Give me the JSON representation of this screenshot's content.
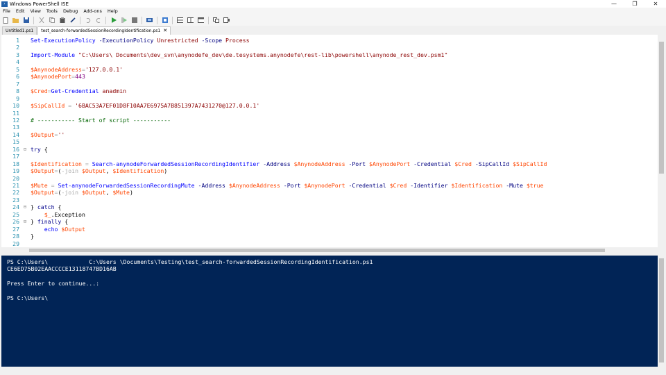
{
  "window": {
    "title": "Windows PowerShell ISE",
    "min": "—",
    "max": "❐",
    "close": "✕"
  },
  "menu": [
    "File",
    "Edit",
    "View",
    "Tools",
    "Debug",
    "Add-ons",
    "Help"
  ],
  "toolbar": {
    "icons": [
      "new-icon",
      "open-icon",
      "save-icon",
      "cut-icon",
      "copy-icon",
      "paste-icon",
      "clear-icon",
      "undo-icon",
      "redo-icon",
      "run-icon",
      "run-selection-icon",
      "stop-icon",
      "remote-icon",
      "debug-icon",
      "layout-top-icon",
      "layout-right-icon",
      "layout-max-icon",
      "commands-icon",
      "addon-icon"
    ]
  },
  "tabs": [
    {
      "label": "Untitled1.ps1",
      "active": false
    },
    {
      "label": "test_search-forwardedSessionRecordingIdentification.ps1",
      "active": true,
      "close": "✕"
    }
  ],
  "editor": {
    "lines": [
      {
        "n": "1",
        "fold": "",
        "tokens": [
          [
            "cmd",
            "Set-ExecutionPolicy "
          ],
          [
            "param",
            "-ExecutionPolicy "
          ],
          [
            "str",
            "Unrestricted "
          ],
          [
            "param",
            "-Scope "
          ],
          [
            "str",
            "Process"
          ]
        ]
      },
      {
        "n": "2",
        "fold": "",
        "tokens": []
      },
      {
        "n": "3",
        "fold": "",
        "tokens": [
          [
            "cmd",
            "Import-Module "
          ],
          [
            "str",
            "\"C:\\Users\\ Documents\\dev_svn\\anynodefe_dev\\de.tesystems.anynodefe\\rest-lib\\powershell\\anynode_rest_dev.psm1\""
          ]
        ]
      },
      {
        "n": "4",
        "fold": "",
        "tokens": []
      },
      {
        "n": "5",
        "fold": "",
        "tokens": [
          [
            "var",
            "$AnynodeAddress"
          ],
          [
            "op",
            "="
          ],
          [
            "str",
            "'127.0.0.1'"
          ]
        ]
      },
      {
        "n": "6",
        "fold": "",
        "tokens": [
          [
            "var",
            "$AnynodePort"
          ],
          [
            "op",
            "="
          ],
          [
            "num",
            "443"
          ]
        ]
      },
      {
        "n": "7",
        "fold": "",
        "tokens": []
      },
      {
        "n": "8",
        "fold": "",
        "tokens": [
          [
            "var",
            "$Cred"
          ],
          [
            "op",
            "="
          ],
          [
            "cmd",
            "Get-Credential "
          ],
          [
            "str",
            "anadmin"
          ]
        ]
      },
      {
        "n": "9",
        "fold": "",
        "tokens": []
      },
      {
        "n": "10",
        "fold": "",
        "tokens": [
          [
            "var",
            "$SipCallId "
          ],
          [
            "op",
            "= "
          ],
          [
            "str",
            "'6BAC53A7EF01D8F10AA7E6975A7B851397A7431270@127.0.0.1'"
          ]
        ]
      },
      {
        "n": "11",
        "fold": "",
        "tokens": []
      },
      {
        "n": "12",
        "fold": "",
        "tokens": [
          [
            "cmt",
            "# ----------- Start of script -----------"
          ]
        ]
      },
      {
        "n": "13",
        "fold": "",
        "tokens": []
      },
      {
        "n": "14",
        "fold": "",
        "tokens": [
          [
            "var",
            "$Output"
          ],
          [
            "op",
            "="
          ],
          [
            "str",
            "''"
          ]
        ]
      },
      {
        "n": "15",
        "fold": "",
        "tokens": []
      },
      {
        "n": "16",
        "fold": "⊟",
        "tokens": [
          [
            "kw",
            "try "
          ],
          [
            "txt",
            "{"
          ]
        ]
      },
      {
        "n": "17",
        "fold": "",
        "tokens": []
      },
      {
        "n": "18",
        "fold": "",
        "tokens": [
          [
            "var",
            "$Identification "
          ],
          [
            "op",
            "= "
          ],
          [
            "cmd",
            "Search-anynodeForwardedSessionRecordingIdentifier "
          ],
          [
            "param",
            "-Address "
          ],
          [
            "var",
            "$AnynodeAddress "
          ],
          [
            "param",
            "-Port "
          ],
          [
            "var",
            "$AnynodePort "
          ],
          [
            "param",
            "-Credential "
          ],
          [
            "var",
            "$Cred "
          ],
          [
            "param",
            "-SipCallId "
          ],
          [
            "var",
            "$SipCallId"
          ]
        ]
      },
      {
        "n": "19",
        "fold": "",
        "tokens": [
          [
            "var",
            "$Output"
          ],
          [
            "op",
            "="
          ],
          [
            "txt",
            "("
          ],
          [
            "op",
            "-join "
          ],
          [
            "var",
            "$Output"
          ],
          [
            "txt",
            ", "
          ],
          [
            "var",
            "$Identification"
          ],
          [
            "txt",
            ")"
          ]
        ]
      },
      {
        "n": "20",
        "fold": "",
        "tokens": []
      },
      {
        "n": "21",
        "fold": "",
        "tokens": [
          [
            "var",
            "$Mute "
          ],
          [
            "op",
            "= "
          ],
          [
            "cmd",
            "Set-anynodeForwardedSessionRecordingMute "
          ],
          [
            "param",
            "-Address "
          ],
          [
            "var",
            "$AnynodeAddress "
          ],
          [
            "param",
            "-Port "
          ],
          [
            "var",
            "$AnynodePort "
          ],
          [
            "param",
            "-Credential "
          ],
          [
            "var",
            "$Cred "
          ],
          [
            "param",
            "-Identifier "
          ],
          [
            "var",
            "$Identification "
          ],
          [
            "param",
            "-Mute "
          ],
          [
            "var",
            "$true"
          ]
        ]
      },
      {
        "n": "22",
        "fold": "",
        "tokens": [
          [
            "var",
            "$Output"
          ],
          [
            "op",
            "="
          ],
          [
            "txt",
            "("
          ],
          [
            "op",
            "-join "
          ],
          [
            "var",
            "$Output"
          ],
          [
            "txt",
            ", "
          ],
          [
            "var",
            "$Mute"
          ],
          [
            "txt",
            ")"
          ]
        ]
      },
      {
        "n": "23",
        "fold": "",
        "tokens": []
      },
      {
        "n": "24",
        "fold": "⊟",
        "tokens": [
          [
            "txt",
            "} "
          ],
          [
            "kw",
            "catch "
          ],
          [
            "txt",
            "{"
          ]
        ]
      },
      {
        "n": "25",
        "fold": "",
        "tokens": [
          [
            "txt",
            "    "
          ],
          [
            "var",
            "$_"
          ],
          [
            "txt",
            ".Exception"
          ]
        ]
      },
      {
        "n": "26",
        "fold": "⊟",
        "tokens": [
          [
            "txt",
            "} "
          ],
          [
            "kw",
            "finally "
          ],
          [
            "txt",
            "{"
          ]
        ]
      },
      {
        "n": "27",
        "fold": "",
        "tokens": [
          [
            "txt",
            "    "
          ],
          [
            "cmd",
            "echo "
          ],
          [
            "var",
            "$Output"
          ]
        ]
      },
      {
        "n": "28",
        "fold": "",
        "tokens": [
          [
            "txt",
            "}"
          ]
        ]
      },
      {
        "n": "29",
        "fold": "",
        "tokens": []
      }
    ]
  },
  "console": {
    "lines": [
      "PS C:\\Users\\            C:\\Users \\Documents\\Testing\\test_search-forwardedSessionRecordingIdentification.ps1",
      "CE6ED75B02EAACCCCE13118747BD16AB",
      "",
      "Press Enter to continue...:",
      "",
      "PS C:\\Users\\"
    ]
  },
  "colors": {
    "console_bg": "#012456",
    "cmdlet": "#0000ff",
    "parameter": "#000080",
    "variable": "#ff4500",
    "string": "#8b0000",
    "comment": "#006400",
    "keyword": "#00008b",
    "line_number": "#2b91af"
  }
}
